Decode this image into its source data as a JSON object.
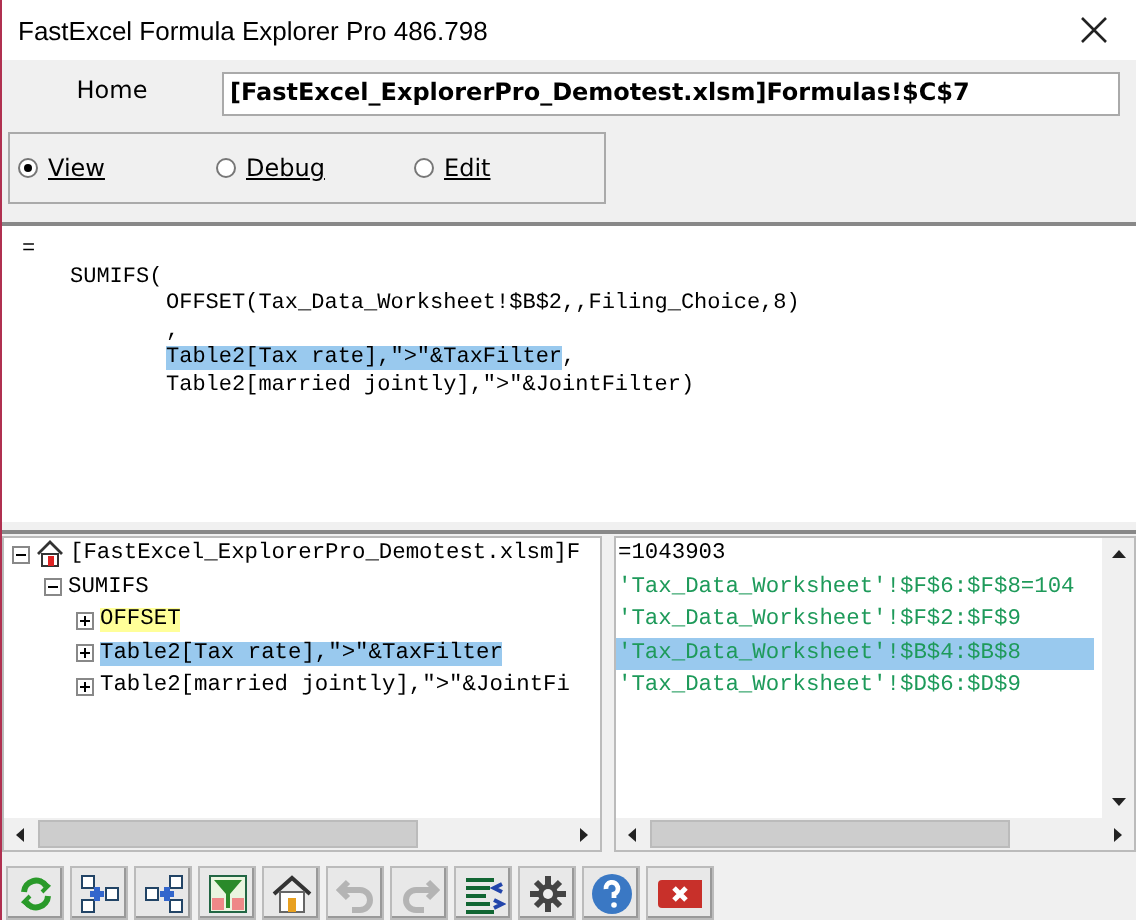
{
  "window": {
    "title": "FastExcel Formula Explorer Pro 486.798"
  },
  "home": {
    "label": "Home",
    "address": "[FastExcel_ExplorerPro_Demotest.xlsm]Formulas!$C$7"
  },
  "modes": [
    {
      "label": "View",
      "selected": true
    },
    {
      "label": "Debug",
      "selected": false
    },
    {
      "label": "Edit",
      "selected": false
    }
  ],
  "formula": [
    {
      "text": "=",
      "selected": false,
      "children": [
        {
          "text": "SUMIFS(",
          "selected": false,
          "children": [
            {
              "text": "OFFSET(Tax_Data_Worksheet!$B$2,,Filing_Choice,8)",
              "selected": false
            },
            {
              "text": ",",
              "selected": false
            },
            {
              "text": "Table2[Tax rate],\">\"&TaxFilter",
              "trail": ",",
              "selected": true
            },
            {
              "text": "Table2[married jointly],\">\"&JointFilter)",
              "selected": false
            }
          ]
        }
      ]
    }
  ],
  "tree": [
    {
      "text": "[FastExcel_ExplorerPro_Demotest.xlsm]F",
      "home": true,
      "expanded": true,
      "selected": false,
      "marked": false,
      "children": [
        {
          "text": "SUMIFS",
          "expanded": true,
          "selected": false,
          "marked": false,
          "children": [
            {
              "text": "OFFSET",
              "expanded": false,
              "selected": false,
              "marked": true
            },
            {
              "text": "Table2[Tax rate],\">\"&TaxFilter",
              "expanded": false,
              "selected": true,
              "marked": false
            },
            {
              "text": "Table2[married jointly],\">\"&JointFi",
              "expanded": false,
              "selected": false,
              "marked": false
            }
          ]
        }
      ]
    }
  ],
  "values": [
    {
      "text": "=1043903",
      "color": "#000000",
      "selected": false
    },
    {
      "text": "'Tax_Data_Worksheet'!$F$6:$F$8=104",
      "color": "#1e9a5a",
      "selected": false
    },
    {
      "text": "'Tax_Data_Worksheet'!$F$2:$F$9",
      "color": "#1e9a5a",
      "selected": false
    },
    {
      "text": "'Tax_Data_Worksheet'!$B$4:$B$8",
      "color": "#1e9a5a",
      "selected": true
    },
    {
      "text": "'Tax_Data_Worksheet'!$D$6:$D$9",
      "color": "#1e9a5a",
      "selected": false
    }
  ],
  "toolbar": [
    {
      "kind": "refresh",
      "disabled": false
    },
    {
      "kind": "precedents",
      "disabled": false
    },
    {
      "kind": "dependents",
      "disabled": false
    },
    {
      "kind": "filter",
      "disabled": false
    },
    {
      "kind": "home",
      "disabled": false
    },
    {
      "kind": "undo",
      "disabled": true
    },
    {
      "kind": "redo",
      "disabled": true
    },
    {
      "kind": "indent",
      "disabled": false
    },
    {
      "kind": "settings",
      "disabled": false
    },
    {
      "kind": "help",
      "disabled": false
    },
    {
      "kind": "close",
      "disabled": false
    }
  ]
}
